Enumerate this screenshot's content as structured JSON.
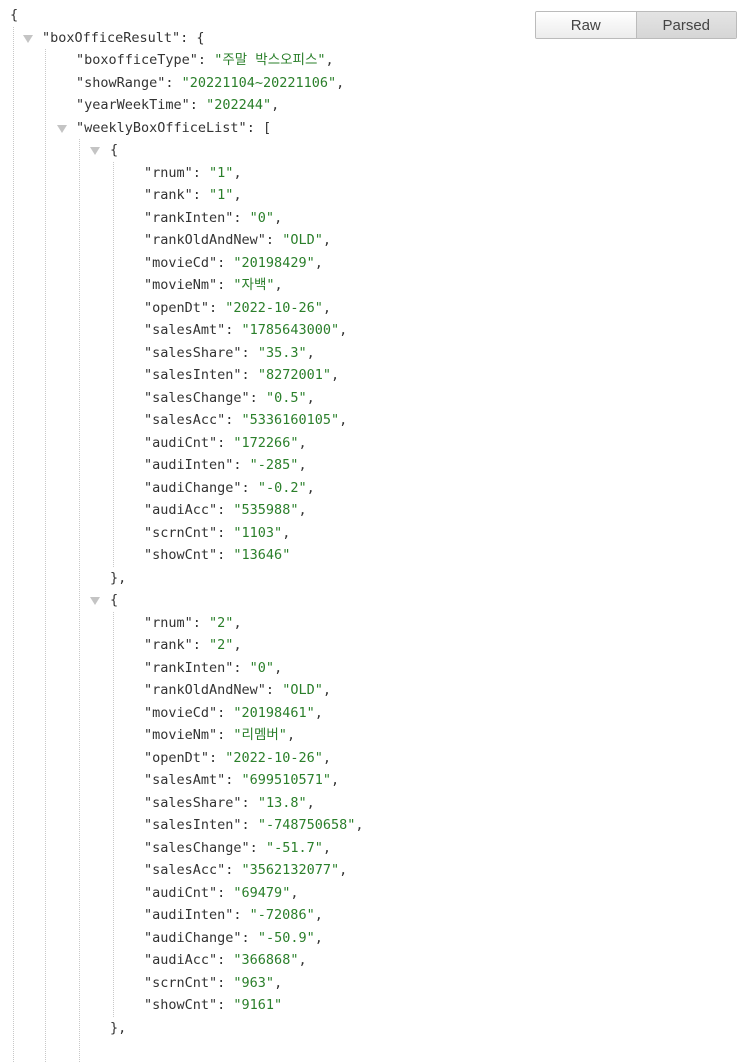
{
  "toolbar": {
    "raw_label": "Raw",
    "parsed_label": "Parsed",
    "active": "Parsed"
  },
  "json_view": {
    "root_key": "boxOfficeResult",
    "result_fields": [
      {
        "key": "boxofficeType",
        "value": "주말 박스오피스"
      },
      {
        "key": "showRange",
        "value": "20221104~20221106"
      },
      {
        "key": "yearWeekTime",
        "value": "202244"
      }
    ],
    "list_key": "weeklyBoxOfficeList",
    "items": [
      [
        {
          "key": "rnum",
          "value": "1"
        },
        {
          "key": "rank",
          "value": "1"
        },
        {
          "key": "rankInten",
          "value": "0"
        },
        {
          "key": "rankOldAndNew",
          "value": "OLD"
        },
        {
          "key": "movieCd",
          "value": "20198429"
        },
        {
          "key": "movieNm",
          "value": "자백"
        },
        {
          "key": "openDt",
          "value": "2022-10-26"
        },
        {
          "key": "salesAmt",
          "value": "1785643000"
        },
        {
          "key": "salesShare",
          "value": "35.3"
        },
        {
          "key": "salesInten",
          "value": "8272001"
        },
        {
          "key": "salesChange",
          "value": "0.5"
        },
        {
          "key": "salesAcc",
          "value": "5336160105"
        },
        {
          "key": "audiCnt",
          "value": "172266"
        },
        {
          "key": "audiInten",
          "value": "-285"
        },
        {
          "key": "audiChange",
          "value": "-0.2"
        },
        {
          "key": "audiAcc",
          "value": "535988"
        },
        {
          "key": "scrnCnt",
          "value": "1103"
        },
        {
          "key": "showCnt",
          "value": "13646"
        }
      ],
      [
        {
          "key": "rnum",
          "value": "2"
        },
        {
          "key": "rank",
          "value": "2"
        },
        {
          "key": "rankInten",
          "value": "0"
        },
        {
          "key": "rankOldAndNew",
          "value": "OLD"
        },
        {
          "key": "movieCd",
          "value": "20198461"
        },
        {
          "key": "movieNm",
          "value": "리멤버"
        },
        {
          "key": "openDt",
          "value": "2022-10-26"
        },
        {
          "key": "salesAmt",
          "value": "699510571"
        },
        {
          "key": "salesShare",
          "value": "13.8"
        },
        {
          "key": "salesInten",
          "value": "-748750658"
        },
        {
          "key": "salesChange",
          "value": "-51.7"
        },
        {
          "key": "salesAcc",
          "value": "3562132077"
        },
        {
          "key": "audiCnt",
          "value": "69479"
        },
        {
          "key": "audiInten",
          "value": "-72086"
        },
        {
          "key": "audiChange",
          "value": "-50.9"
        },
        {
          "key": "audiAcc",
          "value": "366868"
        },
        {
          "key": "scrnCnt",
          "value": "963"
        },
        {
          "key": "showCnt",
          "value": "9161"
        }
      ]
    ]
  },
  "colors": {
    "string_value": "#2a7f2a",
    "key_text": "#333333",
    "toggle_triangle": "#c4c4c4"
  }
}
